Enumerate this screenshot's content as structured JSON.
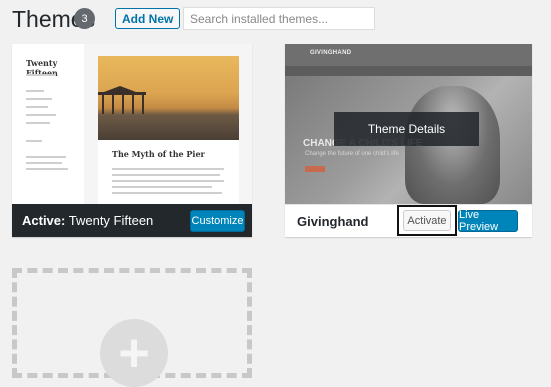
{
  "header": {
    "title": "Themes",
    "count": "3",
    "add_new_label": "Add New",
    "search_placeholder": "Search installed themes..."
  },
  "themes": [
    {
      "name": "Twenty Fifteen",
      "active_prefix": "Active:",
      "customize_label": "Customize",
      "screenshot": {
        "site_title": "Twenty Fifteen",
        "post_title": "The Myth of the Pier"
      }
    },
    {
      "name": "Givinghand",
      "activate_label": "Activate",
      "live_preview_label": "Live Preview",
      "details_label": "Theme Details",
      "screenshot": {
        "logo": "GIVINGHAND",
        "headline": "CHANGE A CHILD'S LIFE",
        "subline": "Change the future of one child's life"
      }
    }
  ],
  "add_theme": {
    "icon": "plus-icon"
  },
  "colors": {
    "primary": "#0085ba",
    "active_footer": "#23282d",
    "count_badge": "#646970"
  }
}
